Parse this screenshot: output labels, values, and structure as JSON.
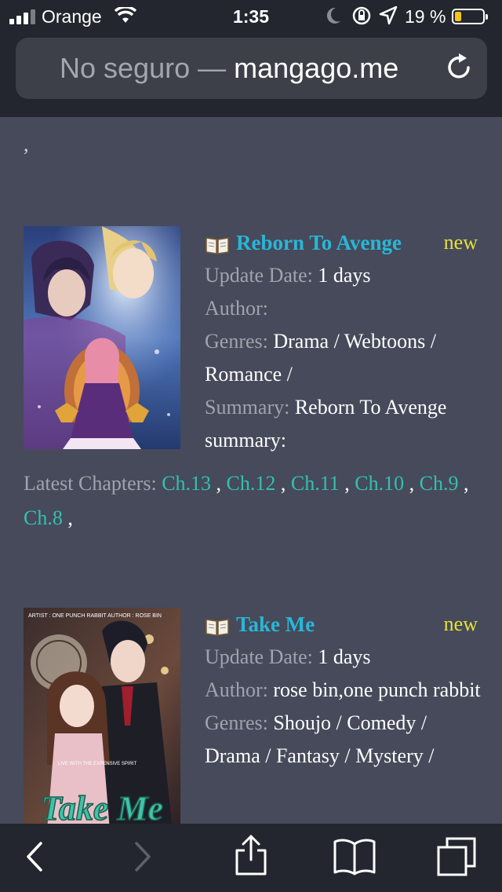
{
  "status": {
    "carrier": "Orange",
    "time": "1:35",
    "battery_pct": "19 %",
    "battery_level": 0.19,
    "battery_color": "#f5c518"
  },
  "url_bar": {
    "security_label": "No seguro —",
    "domain": "mangago.me"
  },
  "page": {
    "leading_text": ","
  },
  "labels": {
    "update_date": "Update Date:",
    "author": "Author:",
    "genres": "Genres:",
    "summary": "Summary:",
    "latest_chapters": "Latest Chapters:",
    "new_badge": "new"
  },
  "manga": [
    {
      "title": "Reborn To Avenge",
      "update_date": "1 days",
      "author": "",
      "genres": "Drama / Webtoons / Romance /",
      "summary": "Reborn To Avenge summary:",
      "chapters": [
        "Ch.13",
        "Ch.12",
        "Ch.11",
        "Ch.10",
        "Ch.9",
        "Ch.8"
      ]
    },
    {
      "title": "Take Me",
      "update_date": "1 days",
      "author": "rose bin,one punch rabbit",
      "genres_visible": "Shoujo / Comedy / Drama / Fantasy / Mystery /",
      "cover_text_top": "ARTIST : ONE PUNCH RABBIT  AUTHOR : ROSE BIN",
      "cover_text_mid": "LIVE WITH THE EXPENSIVE SPIRIT",
      "cover_title_art": "Take Me"
    }
  ],
  "colors": {
    "title": "#29b6d8",
    "chapter_link": "#33c0b0",
    "new_badge": "#e5e23a",
    "background": "#464a5a",
    "chrome": "#23262e"
  },
  "icons": [
    "signal-icon",
    "wifi-icon",
    "moon-icon",
    "rotation-lock-icon",
    "location-arrow-icon",
    "battery-icon",
    "reload-icon",
    "book-icon",
    "chevron-up-icon",
    "back-icon",
    "forward-icon",
    "share-icon",
    "bookmarks-icon",
    "tabs-icon"
  ]
}
